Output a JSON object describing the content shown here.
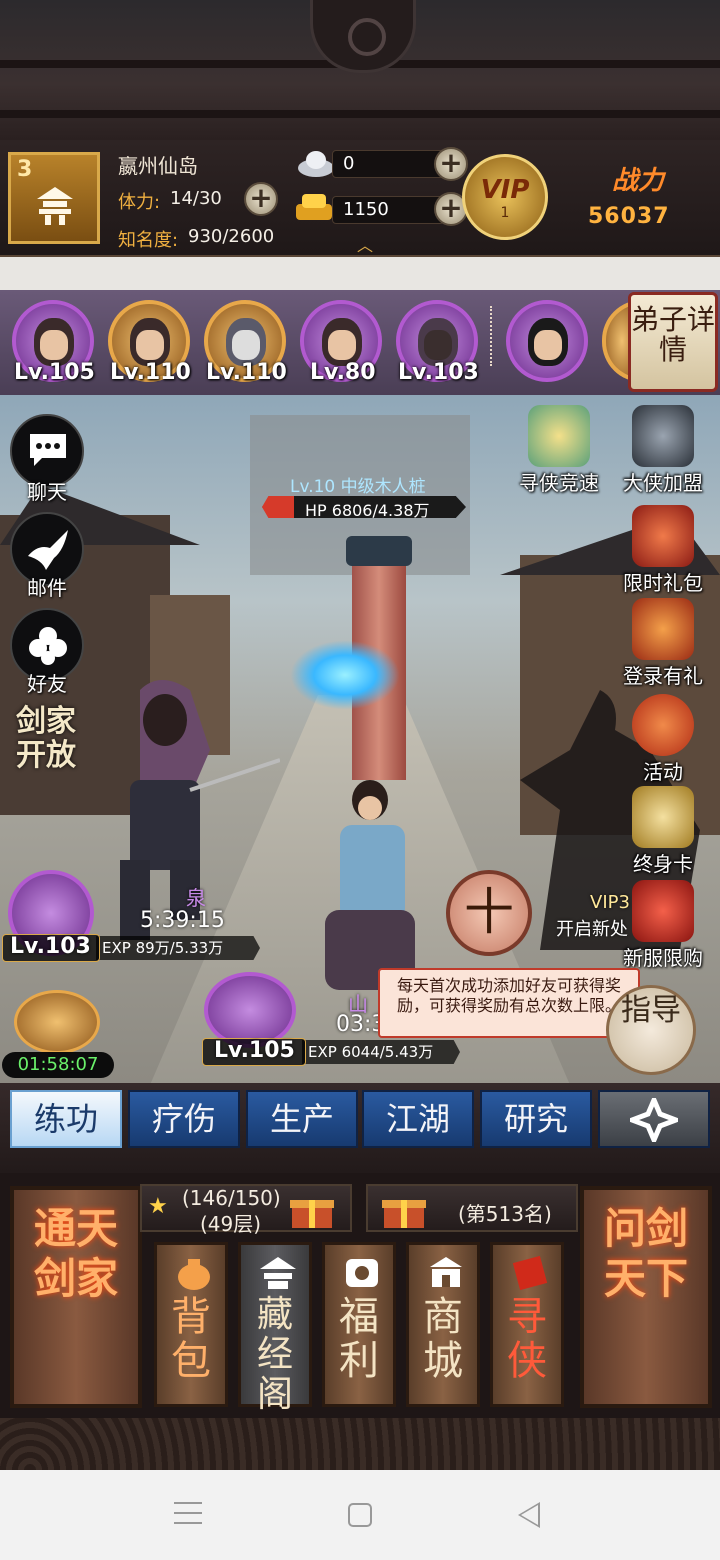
{
  "header": {
    "rank": "3",
    "player_name": "嬴州仙岛",
    "stamina_label": "体力:",
    "stamina_value": "14/30",
    "fame_label": "知名度:",
    "fame_value": "930/2600",
    "silver_value": "0",
    "gold_value": "1150",
    "vip_label": "VIP",
    "vip_level": "1",
    "power_label": "战力",
    "power_value": "56037"
  },
  "roster": {
    "heroes": [
      {
        "level": "Lv.105"
      },
      {
        "level": "Lv.110"
      },
      {
        "level": "Lv.110"
      },
      {
        "level": "Lv.80"
      },
      {
        "level": "Lv.103"
      }
    ],
    "detail_button": "弟子详情"
  },
  "battle": {
    "target_name": "Lv.10 中级木人桩",
    "target_hp": "HP 6806/4.38万",
    "hp_fraction": 0.155,
    "unit1": {
      "level": "Lv.103",
      "name": "泉",
      "timer": "5:39:15",
      "exp": "EXP 89万/5.33万"
    },
    "unit2": {
      "level": "Lv.105",
      "name": "山",
      "timer": "03:3",
      "exp": "EXP 6044/5.43万"
    },
    "vip_notice": "VIP3",
    "new_server_text": "开启新处",
    "ten_button": "十",
    "tooltip": "每天首次成功添加好友可获得奖励，可获得奖励有总次数上限。",
    "guide_button": "指导",
    "timer": "01:58:07"
  },
  "left_menu": {
    "chat": "聊天",
    "mail": "邮件",
    "friends": "好友",
    "jian_badge": "剑家开放"
  },
  "right_menu": {
    "items": [
      "寻侠竞速",
      "大侠加盟",
      "限时礼包",
      "登录有礼",
      "活动",
      "终身卡",
      "新服限购"
    ]
  },
  "tabs": [
    "练功",
    "疗伤",
    "生产",
    "江湖",
    "研究"
  ],
  "bottom": {
    "left_pillar": "通天剑家",
    "right_pillar": "问剑天下",
    "stars": "(146/150)",
    "floor": "(49层)",
    "rank": "(第513名)",
    "menu": [
      "背包",
      "藏经阁",
      "福利",
      "商城",
      "寻侠"
    ]
  },
  "colors": {
    "tab_blue": "#2a5aa0",
    "accent_gold": "#d9a94a",
    "power_orange": "#ff8a2a",
    "tooltip_bg": "#fbe4d8",
    "timer_green": "#6af06a"
  }
}
